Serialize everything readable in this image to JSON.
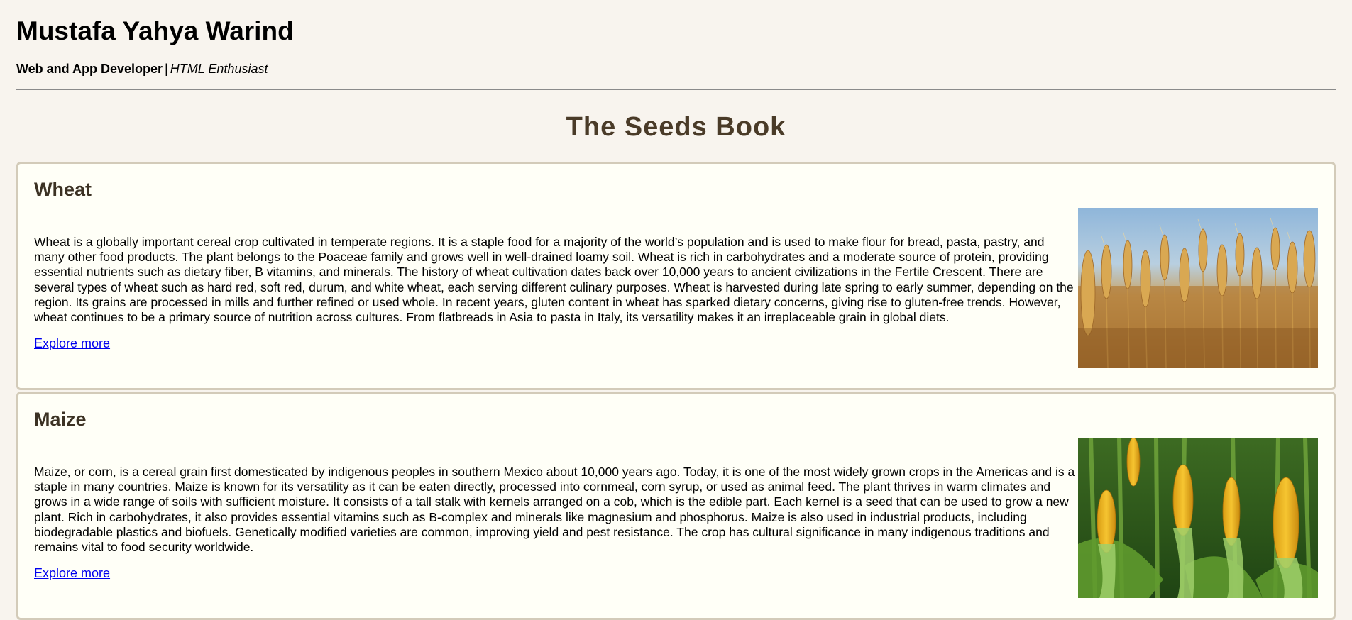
{
  "header": {
    "author_name": "Mustafa Yahya Warind",
    "role_main": "Web and App Developer",
    "role_separator": "|",
    "role_alt": "HTML Enthusiast"
  },
  "book": {
    "title": "The Seeds Book"
  },
  "cards": [
    {
      "title": "Wheat",
      "description": "Wheat is a globally important cereal crop cultivated in temperate regions. It is a staple food for a majority of the world’s population and is used to make flour for bread, pasta, pastry, and many other food products. The plant belongs to the Poaceae family and grows well in well-drained loamy soil. Wheat is rich in carbohydrates and a moderate source of protein, providing essential nutrients such as dietary fiber, B vitamins, and minerals. The history of wheat cultivation dates back over 10,000 years to ancient civilizations in the Fertile Crescent. There are several types of wheat such as hard red, soft red, durum, and white wheat, each serving different culinary purposes. Wheat is harvested during late spring to early summer, depending on the region. Its grains are processed in mills and further refined or used whole. In recent years, gluten content in wheat has sparked dietary concerns, giving rise to gluten-free trends. However, wheat continues to be a primary source of nutrition across cultures. From flatbreads in Asia to pasta in Italy, its versatility makes it an irreplaceable grain in global diets.",
      "link_label": "Explore more",
      "image_subject": "wheat-field-photo"
    },
    {
      "title": "Maize",
      "description": "Maize, or corn, is a cereal grain first domesticated by indigenous peoples in southern Mexico about 10,000 years ago. Today, it is one of the most widely grown crops in the Americas and is a staple in many countries. Maize is known for its versatility as it can be eaten directly, processed into cornmeal, corn syrup, or used as animal feed. The plant thrives in warm climates and grows in a wide range of soils with sufficient moisture. It consists of a tall stalk with kernels arranged on a cob, which is the edible part. Each kernel is a seed that can be used to grow a new plant. Rich in carbohydrates, it also provides essential vitamins such as B-complex and minerals like magnesium and phosphorus. Maize is also used in industrial products, including biodegradable plastics and biofuels. Genetically modified varieties are common, improving yield and pest resistance. The crop has cultural significance in many indigenous traditions and remains vital to food security worldwide.",
      "link_label": "Explore more",
      "image_subject": "corn-cobs-photo"
    }
  ],
  "colors": {
    "page_background": "#f8f4ee",
    "card_background": "#fffff7",
    "card_border": "#d3cbb9",
    "heading_brown": "#4a3b28",
    "link_blue": "#0000ee"
  }
}
